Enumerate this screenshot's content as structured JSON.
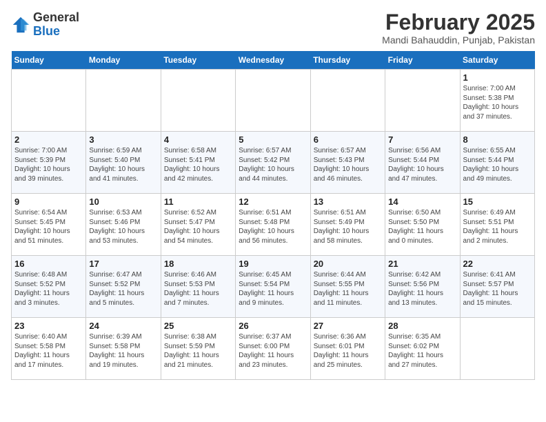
{
  "header": {
    "logo": {
      "general": "General",
      "blue": "Blue"
    },
    "title": "February 2025",
    "location": "Mandi Bahauddin, Punjab, Pakistan"
  },
  "days_of_week": [
    "Sunday",
    "Monday",
    "Tuesday",
    "Wednesday",
    "Thursday",
    "Friday",
    "Saturday"
  ],
  "weeks": [
    [
      {
        "day": "",
        "info": ""
      },
      {
        "day": "",
        "info": ""
      },
      {
        "day": "",
        "info": ""
      },
      {
        "day": "",
        "info": ""
      },
      {
        "day": "",
        "info": ""
      },
      {
        "day": "",
        "info": ""
      },
      {
        "day": "1",
        "info": "Sunrise: 7:00 AM\nSunset: 5:38 PM\nDaylight: 10 hours\nand 37 minutes."
      }
    ],
    [
      {
        "day": "2",
        "info": "Sunrise: 7:00 AM\nSunset: 5:39 PM\nDaylight: 10 hours\nand 39 minutes."
      },
      {
        "day": "3",
        "info": "Sunrise: 6:59 AM\nSunset: 5:40 PM\nDaylight: 10 hours\nand 41 minutes."
      },
      {
        "day": "4",
        "info": "Sunrise: 6:58 AM\nSunset: 5:41 PM\nDaylight: 10 hours\nand 42 minutes."
      },
      {
        "day": "5",
        "info": "Sunrise: 6:57 AM\nSunset: 5:42 PM\nDaylight: 10 hours\nand 44 minutes."
      },
      {
        "day": "6",
        "info": "Sunrise: 6:57 AM\nSunset: 5:43 PM\nDaylight: 10 hours\nand 46 minutes."
      },
      {
        "day": "7",
        "info": "Sunrise: 6:56 AM\nSunset: 5:44 PM\nDaylight: 10 hours\nand 47 minutes."
      },
      {
        "day": "8",
        "info": "Sunrise: 6:55 AM\nSunset: 5:44 PM\nDaylight: 10 hours\nand 49 minutes."
      }
    ],
    [
      {
        "day": "9",
        "info": "Sunrise: 6:54 AM\nSunset: 5:45 PM\nDaylight: 10 hours\nand 51 minutes."
      },
      {
        "day": "10",
        "info": "Sunrise: 6:53 AM\nSunset: 5:46 PM\nDaylight: 10 hours\nand 53 minutes."
      },
      {
        "day": "11",
        "info": "Sunrise: 6:52 AM\nSunset: 5:47 PM\nDaylight: 10 hours\nand 54 minutes."
      },
      {
        "day": "12",
        "info": "Sunrise: 6:51 AM\nSunset: 5:48 PM\nDaylight: 10 hours\nand 56 minutes."
      },
      {
        "day": "13",
        "info": "Sunrise: 6:51 AM\nSunset: 5:49 PM\nDaylight: 10 hours\nand 58 minutes."
      },
      {
        "day": "14",
        "info": "Sunrise: 6:50 AM\nSunset: 5:50 PM\nDaylight: 11 hours\nand 0 minutes."
      },
      {
        "day": "15",
        "info": "Sunrise: 6:49 AM\nSunset: 5:51 PM\nDaylight: 11 hours\nand 2 minutes."
      }
    ],
    [
      {
        "day": "16",
        "info": "Sunrise: 6:48 AM\nSunset: 5:52 PM\nDaylight: 11 hours\nand 3 minutes."
      },
      {
        "day": "17",
        "info": "Sunrise: 6:47 AM\nSunset: 5:52 PM\nDaylight: 11 hours\nand 5 minutes."
      },
      {
        "day": "18",
        "info": "Sunrise: 6:46 AM\nSunset: 5:53 PM\nDaylight: 11 hours\nand 7 minutes."
      },
      {
        "day": "19",
        "info": "Sunrise: 6:45 AM\nSunset: 5:54 PM\nDaylight: 11 hours\nand 9 minutes."
      },
      {
        "day": "20",
        "info": "Sunrise: 6:44 AM\nSunset: 5:55 PM\nDaylight: 11 hours\nand 11 minutes."
      },
      {
        "day": "21",
        "info": "Sunrise: 6:42 AM\nSunset: 5:56 PM\nDaylight: 11 hours\nand 13 minutes."
      },
      {
        "day": "22",
        "info": "Sunrise: 6:41 AM\nSunset: 5:57 PM\nDaylight: 11 hours\nand 15 minutes."
      }
    ],
    [
      {
        "day": "23",
        "info": "Sunrise: 6:40 AM\nSunset: 5:58 PM\nDaylight: 11 hours\nand 17 minutes."
      },
      {
        "day": "24",
        "info": "Sunrise: 6:39 AM\nSunset: 5:58 PM\nDaylight: 11 hours\nand 19 minutes."
      },
      {
        "day": "25",
        "info": "Sunrise: 6:38 AM\nSunset: 5:59 PM\nDaylight: 11 hours\nand 21 minutes."
      },
      {
        "day": "26",
        "info": "Sunrise: 6:37 AM\nSunset: 6:00 PM\nDaylight: 11 hours\nand 23 minutes."
      },
      {
        "day": "27",
        "info": "Sunrise: 6:36 AM\nSunset: 6:01 PM\nDaylight: 11 hours\nand 25 minutes."
      },
      {
        "day": "28",
        "info": "Sunrise: 6:35 AM\nSunset: 6:02 PM\nDaylight: 11 hours\nand 27 minutes."
      },
      {
        "day": "",
        "info": ""
      }
    ]
  ]
}
